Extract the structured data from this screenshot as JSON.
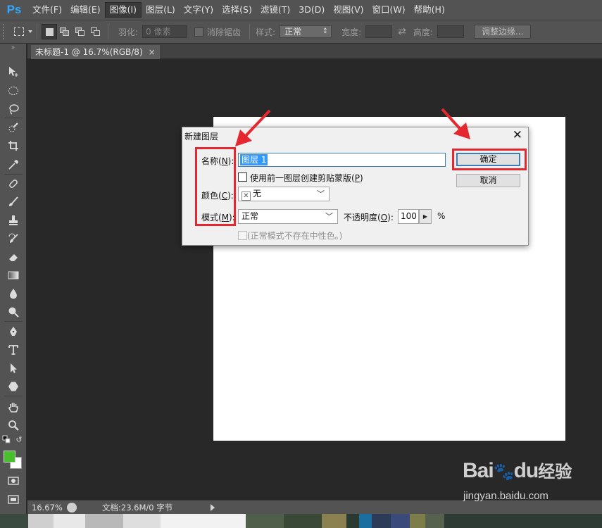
{
  "app": {
    "logo": "Ps",
    "menu": [
      {
        "label": "文件(F)",
        "active": false
      },
      {
        "label": "编辑(E)",
        "active": false
      },
      {
        "label": "图像(I)",
        "active": true
      },
      {
        "label": "图层(L)",
        "active": false
      },
      {
        "label": "文字(Y)",
        "active": false
      },
      {
        "label": "选择(S)",
        "active": false
      },
      {
        "label": "滤镜(T)",
        "active": false
      },
      {
        "label": "3D(D)",
        "active": false
      },
      {
        "label": "视图(V)",
        "active": false
      },
      {
        "label": "窗口(W)",
        "active": false
      },
      {
        "label": "帮助(H)",
        "active": false
      }
    ]
  },
  "options_bar": {
    "feather_label": "羽化:",
    "feather_value": "0 像素",
    "antialias_label": "消除锯齿",
    "style_label": "样式:",
    "style_value": "正常",
    "width_label": "宽度:",
    "height_label": "高度:",
    "refine_edge_label": "调整边缘..."
  },
  "document": {
    "tab_title": "未标题-1 @ 16.7%(RGB/8)",
    "tab_close": "×",
    "canvas_color": "#ffffff"
  },
  "toolbox": {
    "collapse_glyph": "»",
    "tools": [
      "move-tool",
      "elliptical-marquee-tool",
      "lasso-tool",
      "quick-selection-tool",
      "crop-tool",
      "eyedropper-tool",
      "spot-healing-tool",
      "brush-tool",
      "clone-stamp-tool",
      "history-brush-tool",
      "eraser-tool",
      "gradient-tool",
      "blur-tool",
      "dodge-tool",
      "pen-tool",
      "type-tool",
      "path-selection-tool",
      "shape-tool",
      "hand-tool",
      "zoom-tool"
    ],
    "foreground_color": "#47c12b",
    "background_color": "#ffffff"
  },
  "status_bar": {
    "zoom": "16.67%",
    "doc_info": "文档:23.6M/0 字节"
  },
  "dialog": {
    "title": "新建图层",
    "close_glyph": "✕",
    "name_label_pre": "名称(",
    "name_label_key": "N",
    "name_label_post": "):",
    "name_value": "图层 1",
    "clip_label_pre": "使用前一图层创建剪贴蒙版(",
    "clip_label_key": "P",
    "clip_label_post": ")",
    "clip_checked": false,
    "color_label_pre": "颜色(",
    "color_label_key": "C",
    "color_label_post": "):",
    "color_value": "无",
    "color_swatch_glyph": "✕",
    "mode_label_pre": "模式(",
    "mode_label_key": "M",
    "mode_label_post": "):",
    "mode_value": "正常",
    "opacity_label_pre": "不透明度(",
    "opacity_label_key": "O",
    "opacity_label_post": "):",
    "opacity_value": "100",
    "opacity_unit": "%",
    "neutral_label": "(正常模式不存在中性色。)",
    "neutral_enabled": false,
    "ok_label": "确定",
    "cancel_label": "取消"
  },
  "annotation": {
    "highlight_color": "#e5282f"
  },
  "watermark": {
    "logo_pre": "Bai",
    "logo_mid": "du",
    "logo_cn": "经验",
    "url": "jingyan.baidu.com"
  }
}
